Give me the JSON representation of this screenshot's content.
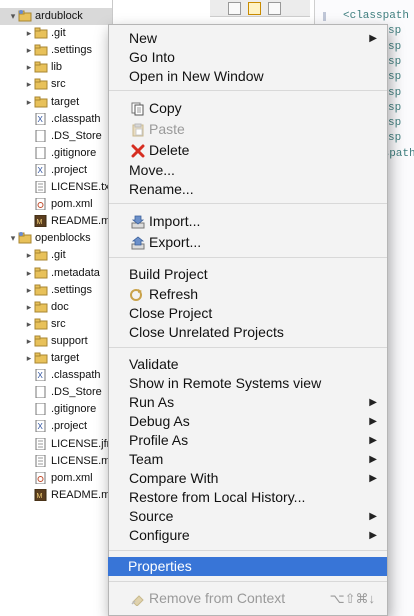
{
  "tree": {
    "items": [
      {
        "label": "ardublock",
        "icon": "project-icon",
        "selected": true
      },
      {
        "label": ".git",
        "icon": "folder-icon"
      },
      {
        "label": ".settings",
        "icon": "folder-icon"
      },
      {
        "label": "lib",
        "icon": "folder-icon"
      },
      {
        "label": "src",
        "icon": "folder-icon"
      },
      {
        "label": "target",
        "icon": "folder-icon"
      },
      {
        "label": ".classpath",
        "icon": "xml-file-icon"
      },
      {
        "label": ".DS_Store",
        "icon": "file-icon"
      },
      {
        "label": ".gitignore",
        "icon": "file-icon"
      },
      {
        "label": ".project",
        "icon": "xml-file-icon"
      },
      {
        "label": "LICENSE.txt",
        "icon": "text-file-icon"
      },
      {
        "label": "pom.xml",
        "icon": "maven-file-icon"
      },
      {
        "label": "README.md",
        "icon": "markdown-file-icon"
      },
      {
        "label": "openblocks",
        "icon": "project-icon"
      },
      {
        "label": ".git",
        "icon": "folder-icon"
      },
      {
        "label": ".metadata",
        "icon": "folder-icon"
      },
      {
        "label": ".settings",
        "icon": "folder-icon"
      },
      {
        "label": "doc",
        "icon": "folder-icon"
      },
      {
        "label": "src",
        "icon": "folder-icon"
      },
      {
        "label": "support",
        "icon": "folder-icon"
      },
      {
        "label": "target",
        "icon": "folder-icon"
      },
      {
        "label": ".classpath",
        "icon": "xml-file-icon"
      },
      {
        "label": ".DS_Store",
        "icon": "file-icon"
      },
      {
        "label": ".gitignore",
        "icon": "file-icon"
      },
      {
        "label": ".project",
        "icon": "xml-file-icon"
      },
      {
        "label": "LICENSE.jfree",
        "icon": "text-file-icon"
      },
      {
        "label": "LICENSE.md",
        "icon": "text-file-icon"
      },
      {
        "label": "pom.xml",
        "icon": "maven-file-icon"
      },
      {
        "label": "README.md",
        "icon": "markdown-file-icon"
      }
    ]
  },
  "editor": {
    "lines": [
      "<classpath",
      "<classp",
      "<classp",
      "<classp",
      "<classp",
      "<classp",
      "<classp",
      "<classp",
      "<classp",
      "</classpath"
    ]
  },
  "menu": {
    "items": {
      "new": "New",
      "go_into": "Go Into",
      "open_new_window": "Open in New Window",
      "copy": "Copy",
      "paste": "Paste",
      "delete": "Delete",
      "move": "Move...",
      "rename": "Rename...",
      "import": "Import...",
      "export": "Export...",
      "build_project": "Build Project",
      "refresh": "Refresh",
      "close_project": "Close Project",
      "close_unrelated": "Close Unrelated Projects",
      "validate": "Validate",
      "show_remote": "Show in Remote Systems view",
      "run_as": "Run As",
      "debug_as": "Debug As",
      "profile_as": "Profile As",
      "team": "Team",
      "compare_with": "Compare With",
      "restore_history": "Restore from Local History...",
      "source": "Source",
      "configure": "Configure",
      "properties": "Properties",
      "remove_from_context": "Remove from Context",
      "remove_shortcut": "⌥⇧⌘↓"
    }
  },
  "colors": {
    "highlight": "#3875d7",
    "folder": "#e8c15a",
    "delete_red": "#d62d20"
  }
}
